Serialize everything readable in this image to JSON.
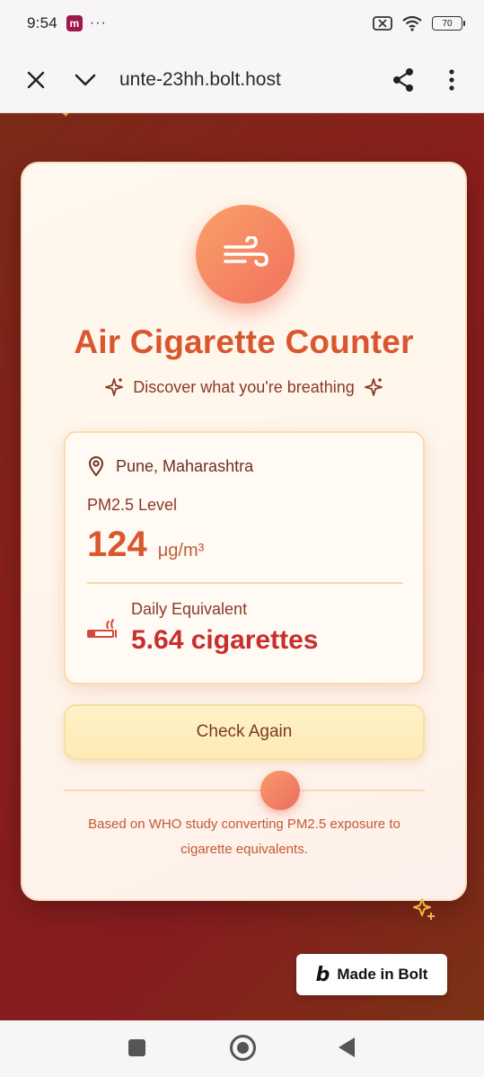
{
  "status_bar": {
    "time": "9:54",
    "app_badge": "m",
    "dots": "···",
    "battery": "70"
  },
  "browser": {
    "url": "unte-23hh.bolt.host",
    "icons": [
      "close-icon",
      "chevron-down-icon",
      "share-icon",
      "more-vert-icon"
    ]
  },
  "app": {
    "title": "Air Cigarette Counter",
    "subtitle": "Discover what you're breathing",
    "location": "Pune, Maharashtra",
    "pm_label": "PM2.5 Level",
    "pm_value": "124",
    "pm_unit": "μg/m³",
    "daily_label": "Daily Equivalent",
    "daily_value": "5.64 cigarettes",
    "check_button": "Check Again",
    "footnote": "Based on WHO study converting PM2.5 exposure to cigarette equivalents.",
    "slider_level": 0.6
  },
  "badge": {
    "label": "Made in Bolt",
    "logo": "b"
  },
  "colors": {
    "accent": "#d9572f",
    "danger": "#c72f2f",
    "background": "#861c1f"
  }
}
